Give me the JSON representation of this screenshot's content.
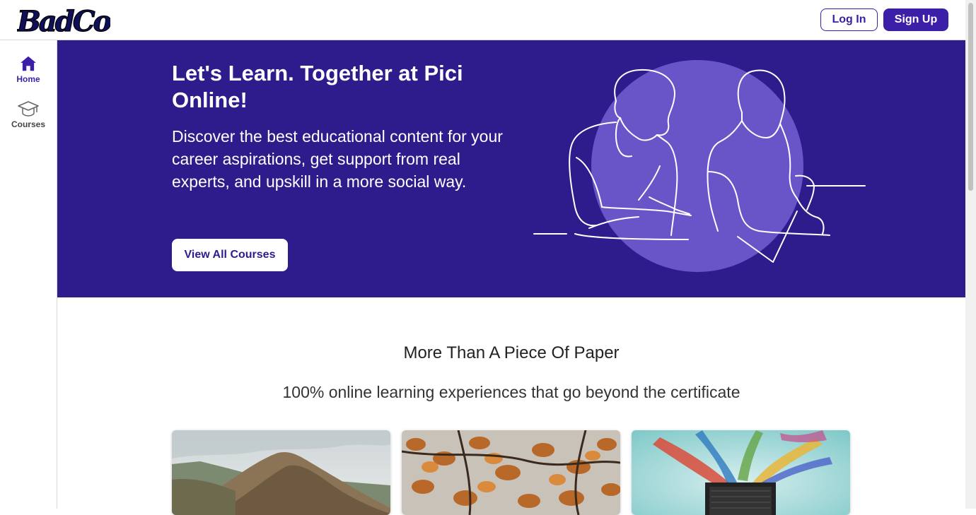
{
  "header": {
    "logo_text": "BadCo",
    "login_label": "Log In",
    "signup_label": "Sign Up"
  },
  "sidebar": {
    "items": [
      {
        "label": "Home",
        "icon": "home-icon",
        "active": true
      },
      {
        "label": "Courses",
        "icon": "graduation-cap-icon",
        "active": false
      }
    ]
  },
  "hero": {
    "title": "Let's Learn. Together at Pici Online!",
    "description": "Discover the best educational content for your career aspirations, get support from real experts, and upskill in a more social way.",
    "cta_label": "View All Courses",
    "illustration": "two-people-studying-line-art"
  },
  "section": {
    "title": "More Than A Piece Of Paper",
    "subtitle": "100% online learning experiences that go beyond the certificate"
  },
  "cards": [
    {
      "image": "mountain-landscape-photo"
    },
    {
      "image": "autumn-leaves-photo"
    },
    {
      "image": "laptop-paint-splash-photo"
    }
  ],
  "colors": {
    "brand": "#3b1fa8",
    "hero_bg": "#2e1c8c",
    "hero_circle": "#6a55c8"
  }
}
